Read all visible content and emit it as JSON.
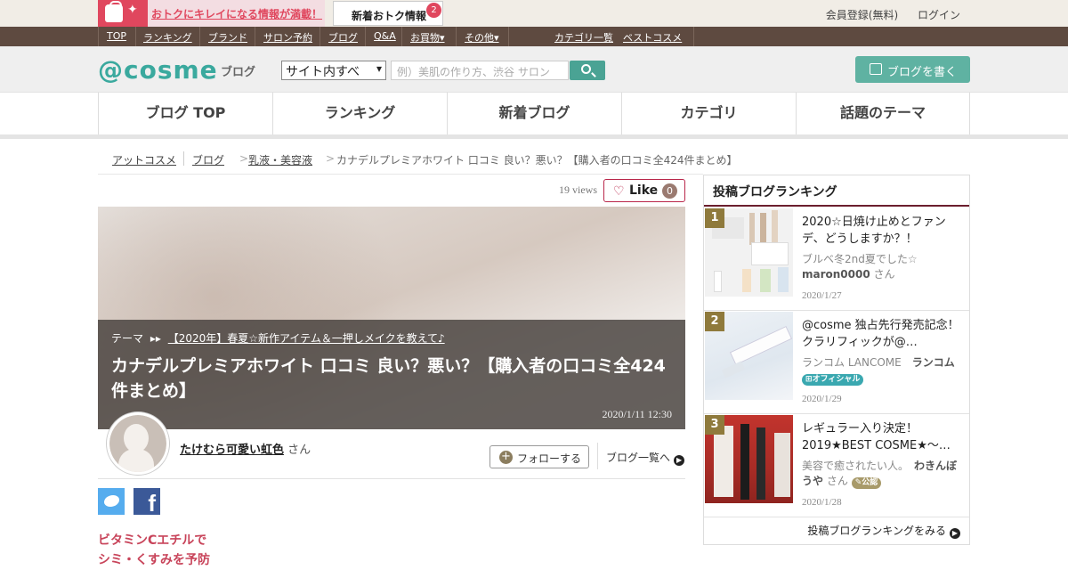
{
  "topbar": {
    "promo_text": "おトクにキレイになる情報が満載！",
    "news_label": "新着おトク情報",
    "news_count": "2",
    "register": "会員登録(無料)",
    "login": "ログイン"
  },
  "menubar": {
    "items": [
      "TOP",
      "ランキング",
      "ブランド",
      "サロン予約",
      "ブログ",
      "Q&A",
      "お買物▾",
      "その他▾"
    ],
    "right": [
      "カテゴリ一覧",
      "ベストコスメ"
    ]
  },
  "header": {
    "logo": "@cosme",
    "logo_sub": "ブログ",
    "search_scope": "サイト内すべ",
    "search_placeholder": "例）美肌の作り方、渋谷 サロン",
    "write_button": "ブログを書く"
  },
  "gnav": [
    "ブログ TOP",
    "ランキング",
    "新着ブログ",
    "カテゴリ",
    "話題のテーマ"
  ],
  "breadcrumb": {
    "items": [
      "アットコスメ",
      "ブログ",
      "乳液・美容液"
    ],
    "current": "カナデルプレミアホワイト 口コミ 良い？悪い？【購入者の口コミ全424件まとめ】"
  },
  "post": {
    "views": "19 views",
    "like_label": "Like",
    "like_count": "0",
    "theme_label": "テーマ",
    "theme": "【2020年】春夏☆新作アイテム＆一押しメイクを教えて♪",
    "title": "カナデルプレミアホワイト 口コミ 良い？悪い？【購入者の口コミ全424件まとめ】",
    "date": "2020/1/11 12:30",
    "author": "たけむら可愛い虹色",
    "author_suffix": "さん",
    "follow": "フォローする",
    "blog_list": "ブログ一覧へ",
    "excerpt_1": "ビタミンCエチルで",
    "excerpt_2": "シミ・くすみを予防"
  },
  "sidebar": {
    "title": "投稿ブログランキング",
    "more": "投稿ブログランキングをみる",
    "ranks": [
      {
        "num": "1",
        "title": "2020☆日焼け止めとファンデ、どうしますか？！",
        "meta": "ブルベ冬2nd夏でした☆",
        "user": "maron0000",
        "suffix": "さん",
        "tag": "",
        "date": "2020/1/27"
      },
      {
        "num": "2",
        "title": "@cosme 独占先行発売記念！クラリフィックが@…",
        "meta": "ランコム LANCOME",
        "user": "ランコム",
        "suffix": "",
        "tag": "オフィシャル",
        "date": "2020/1/29"
      },
      {
        "num": "3",
        "title": "レギュラー入り決定！2019★BEST COSME★～…",
        "meta": "美容で癒されたい人。",
        "user": "わきんぼうや",
        "suffix": "さん",
        "tag": "公認",
        "date": "2020/1/28"
      }
    ]
  },
  "colors": {
    "accent": "#3aa99e",
    "brand_dark": "#5e4a40",
    "like": "#b9264a",
    "promo": "#e0475e"
  }
}
